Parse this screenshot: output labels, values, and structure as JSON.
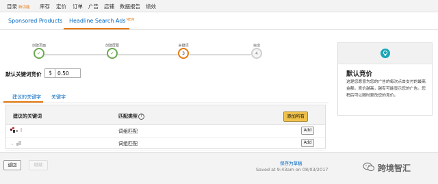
{
  "topnav": {
    "items": [
      {
        "label": "目录",
        "badge": "新功能"
      },
      {
        "label": "库存"
      },
      {
        "label": "定价"
      },
      {
        "label": "订单"
      },
      {
        "label": "广告"
      },
      {
        "label": "店铺"
      },
      {
        "label": "数据报告"
      },
      {
        "label": "绩效"
      }
    ]
  },
  "tabs": {
    "sponsored": "Sponsored Products",
    "headline": "Headline Search Ads",
    "headline_badge": "NEW"
  },
  "steps": [
    {
      "label": "创建页面",
      "state": "done",
      "symbol": "✓"
    },
    {
      "label": "创建屏幕",
      "state": "done",
      "symbol": "✓"
    },
    {
      "label": "关键词",
      "state": "current",
      "symbol": "3"
    },
    {
      "label": "完成",
      "state": "pending",
      "symbol": "4"
    }
  ],
  "bid": {
    "label": "默认关键词竞价",
    "currency": "$",
    "value": "0.50"
  },
  "keyword_tabs": {
    "suggested": "建议的关键字",
    "keywords": "关键字"
  },
  "table": {
    "col_keyword": "建议的关键词",
    "col_match": "匹配类型",
    "help_symbol": "?",
    "add_all": "添加所有",
    "rows": [
      {
        "match": "词组匹配",
        "add": "Add"
      },
      {
        "match": "词组匹配",
        "add": "Add"
      }
    ]
  },
  "sidebar": {
    "title": "默认竞价",
    "body": "这是您愿意为您的广告的每次点击支付的最高金额。竞价越高，越有可能显示您的广告。您稍后可以随时更改您的竞价。"
  },
  "footer": {
    "back": "返回",
    "continue": "继续",
    "save_draft": "保存为草稿",
    "saved": "Saved at 9:43am on 08/03/2017"
  },
  "watermark": {
    "text": "跨境智汇"
  },
  "colors": {
    "accent": "#e47911",
    "link": "#0066c0",
    "done": "#6aa84f",
    "button_yellow": "#f0c14b"
  }
}
